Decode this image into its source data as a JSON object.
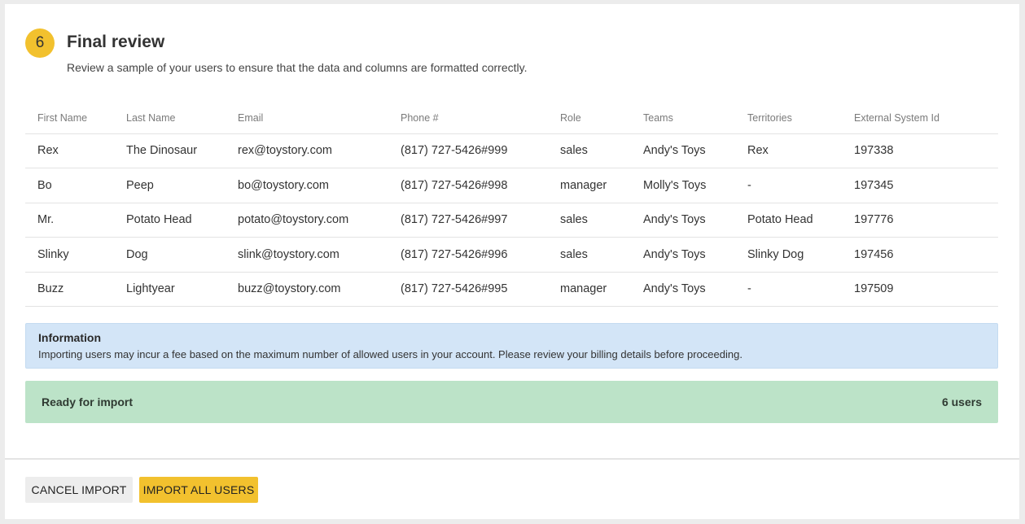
{
  "step": {
    "number": "6",
    "title": "Final review",
    "description": "Review a sample of your users to ensure that the data and columns are formatted correctly."
  },
  "table": {
    "headers": [
      "First Name",
      "Last Name",
      "Email",
      "Phone #",
      "Role",
      "Teams",
      "Territories",
      "External System Id"
    ],
    "rows": [
      [
        "Rex",
        "The Dinosaur",
        "rex@toystory.com",
        "(817) 727-5426#999",
        "sales",
        "Andy's Toys",
        "Rex",
        "197338"
      ],
      [
        "Bo",
        "Peep",
        "bo@toystory.com",
        "(817) 727-5426#998",
        "manager",
        "Molly's Toys",
        "-",
        "197345"
      ],
      [
        "Mr.",
        "Potato Head",
        "potato@toystory.com",
        "(817) 727-5426#997",
        "sales",
        "Andy's Toys",
        "Potato Head",
        "197776"
      ],
      [
        "Slinky",
        "Dog",
        "slink@toystory.com",
        "(817) 727-5426#996",
        "sales",
        "Andy's Toys",
        "Slinky Dog",
        "197456"
      ],
      [
        "Buzz",
        "Lightyear",
        "buzz@toystory.com",
        "(817) 727-5426#995",
        "manager",
        "Andy's Toys",
        "-",
        "197509"
      ]
    ]
  },
  "info": {
    "title": "Information",
    "text": "Importing users may incur a fee based on the maximum number of allowed users in your account. Please review your billing details before proceeding."
  },
  "ready": {
    "label": "Ready for import",
    "count": "6 users"
  },
  "footer": {
    "cancel_label": "CANCEL IMPORT",
    "import_label": "IMPORT ALL USERS"
  },
  "colors": {
    "accent": "#f2c12e",
    "info_bg": "#d3e5f7",
    "success_bg": "#bce3c8"
  }
}
